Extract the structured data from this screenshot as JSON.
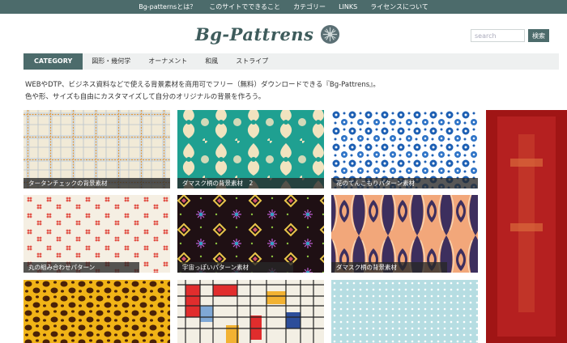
{
  "top_nav": [
    "Bg-patternsとは？",
    "このサイトでできること",
    "カテゴリー",
    "LINKS",
    "ライセンスについて"
  ],
  "logo": {
    "text": "Bg-Pattrens"
  },
  "search": {
    "placeholder": "search",
    "button_label": "検索"
  },
  "category_nav": [
    {
      "label": "CATEGORY",
      "active": true
    },
    {
      "label": "図形・幾何学",
      "active": false
    },
    {
      "label": "オーナメント",
      "active": false
    },
    {
      "label": "和風",
      "active": false
    },
    {
      "label": "ストライプ",
      "active": false
    }
  ],
  "intro": {
    "line1": "WEBやDTP、ビジネス資料などで使える背景素材を商用可でフリー（無料）ダウンロードできる『Bg-Pattrens』。",
    "line2": "色や形、サイズも自由にカスタマイズして自分のオリジナルの背景を作ろう。"
  },
  "tiles": [
    {
      "label": "タータンチェックの背景素材"
    },
    {
      "label": "ダマスク柄の背景素材　2"
    },
    {
      "label": "花のてんこもりパターン素材"
    },
    {
      "label": "丸の組み合わせパターン"
    },
    {
      "label": "宇宙っぽいパターン素材"
    },
    {
      "label": "ダマスク柄の背景素材"
    },
    {
      "label": ""
    },
    {
      "label": ""
    },
    {
      "label": ""
    }
  ],
  "colors": {
    "accent": "#4c6b6b",
    "category_bar": "#eef0f0",
    "ad": "#a81818"
  }
}
